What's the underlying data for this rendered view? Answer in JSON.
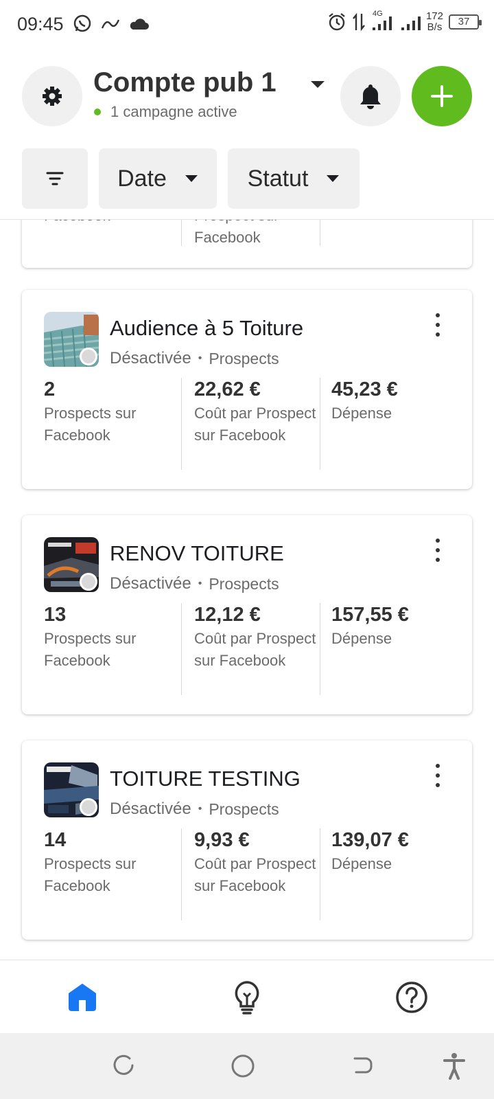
{
  "status_bar": {
    "time": "09:45",
    "network_label": "4G",
    "speed_value": "172",
    "speed_unit": "B/s",
    "battery": "37"
  },
  "header": {
    "account_name": "Compte pub 1",
    "active_campaigns": "1 campagne active",
    "filters": {
      "date_label": "Date",
      "statut_label": "Statut"
    },
    "accent_color": "#5fbb1e"
  },
  "partial_card": {
    "metric1_label": "Facebook",
    "metric2_label_line1": "Prospect sur",
    "metric2_label_line2": "Facebook"
  },
  "campaigns": [
    {
      "name": "Audience à 5 Toiture",
      "status": "Désactivée",
      "objective": "Prospects",
      "results_value": "2",
      "results_label": "Prospects sur Facebook",
      "cost_value": "22,62 €",
      "cost_label": "Coût par Prospect sur Facebook",
      "spend_value": "45,23 €",
      "spend_label": "Dépense"
    },
    {
      "name": "RENOV TOITURE",
      "status": "Désactivée",
      "objective": "Prospects",
      "results_value": "13",
      "results_label": "Prospects sur Facebook",
      "cost_value": "12,12 €",
      "cost_label": "Coût par Prospect sur Facebook",
      "spend_value": "157,55 €",
      "spend_label": "Dépense"
    },
    {
      "name": "TOITURE TESTING",
      "status": "Désactivée",
      "objective": "Prospects",
      "results_value": "14",
      "results_label": "Prospects sur Facebook",
      "cost_value": "9,93 €",
      "cost_label": "Coût par Prospect sur Facebook",
      "spend_value": "139,07 €",
      "spend_label": "Dépense"
    }
  ],
  "bottom_nav": {
    "items": [
      "home-icon",
      "lightbulb-icon",
      "help-icon"
    ],
    "active_color": "#1877f2"
  }
}
